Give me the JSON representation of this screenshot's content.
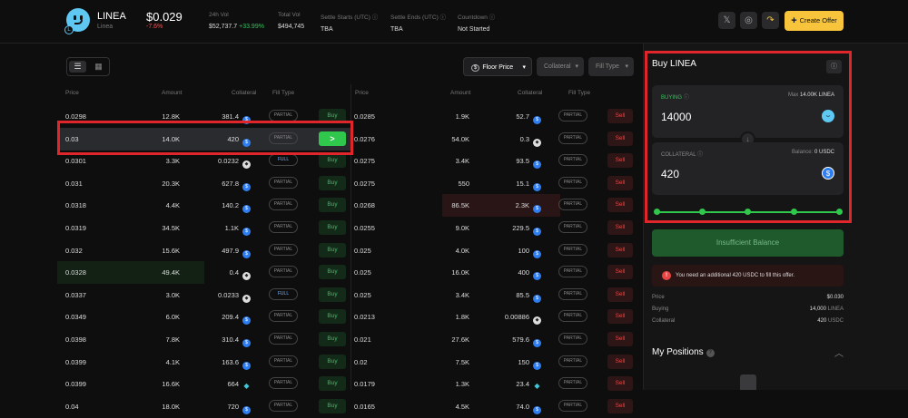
{
  "token": {
    "symbol": "LINEA",
    "name": "Linea",
    "price": "$0.029",
    "change": "-7.6%"
  },
  "stats": [
    {
      "label": "24h Vol",
      "value": "$52,737.7",
      "delta": "+33.99%"
    },
    {
      "label": "Total Vol",
      "value": "$494,745",
      "delta": ""
    },
    {
      "label": "Settle Starts (UTC)",
      "value": "TBA",
      "delta": ""
    },
    {
      "label": "Settle Ends (UTC)",
      "value": "TBA",
      "delta": ""
    },
    {
      "label": "Countdown",
      "value": "Not Started",
      "delta": ""
    }
  ],
  "header_buttons": {
    "x": "𝕏",
    "globe": "◎",
    "share": "↷",
    "create_offer": "Create Offer"
  },
  "filters": {
    "sort": "Floor Price",
    "collateral": "Collateral",
    "fill_type": "Fill Type"
  },
  "columns": {
    "price": "Price",
    "amount": "Amount",
    "collateral": "Collateral",
    "fill_type": "Fill Type"
  },
  "buy_orders": [
    {
      "price": "0.0298",
      "amount": "12.8K",
      "collateral": "381.4",
      "coin": "usdc",
      "fill": "PARTIAL",
      "action": "Buy"
    },
    {
      "price": "0.03",
      "amount": "14.0K",
      "collateral": "420",
      "coin": "usdc",
      "fill": "PARTIAL",
      "action": ">"
    },
    {
      "price": "0.0301",
      "amount": "3.3K",
      "collateral": "0.0232",
      "coin": "eth",
      "fill": "FULL",
      "action": "Buy"
    },
    {
      "price": "0.031",
      "amount": "20.3K",
      "collateral": "627.8",
      "coin": "usdc",
      "fill": "PARTIAL",
      "action": "Buy"
    },
    {
      "price": "0.0318",
      "amount": "4.4K",
      "collateral": "140.2",
      "coin": "usdc",
      "fill": "PARTIAL",
      "action": "Buy"
    },
    {
      "price": "0.0319",
      "amount": "34.5K",
      "collateral": "1.1K",
      "coin": "usdc",
      "fill": "PARTIAL",
      "action": "Buy"
    },
    {
      "price": "0.032",
      "amount": "15.6K",
      "collateral": "497.9",
      "coin": "usdc",
      "fill": "PARTIAL",
      "action": "Buy"
    },
    {
      "price": "0.0328",
      "amount": "49.4K",
      "collateral": "0.4",
      "coin": "eth",
      "fill": "PARTIAL",
      "action": "Buy"
    },
    {
      "price": "0.0337",
      "amount": "3.0K",
      "collateral": "0.0233",
      "coin": "eth",
      "fill": "FULL",
      "action": "Buy"
    },
    {
      "price": "0.0349",
      "amount": "6.0K",
      "collateral": "209.4",
      "coin": "usdc",
      "fill": "PARTIAL",
      "action": "Buy"
    },
    {
      "price": "0.0398",
      "amount": "7.8K",
      "collateral": "310.4",
      "coin": "usdc",
      "fill": "PARTIAL",
      "action": "Buy"
    },
    {
      "price": "0.0399",
      "amount": "4.1K",
      "collateral": "163.6",
      "coin": "usdc",
      "fill": "PARTIAL",
      "action": "Buy"
    },
    {
      "price": "0.0399",
      "amount": "16.6K",
      "collateral": "664",
      "coin": "gem",
      "fill": "PARTIAL",
      "action": "Buy"
    },
    {
      "price": "0.04",
      "amount": "18.0K",
      "collateral": "720",
      "coin": "usdc",
      "fill": "PARTIAL",
      "action": "Buy"
    }
  ],
  "sell_orders": [
    {
      "price": "0.0285",
      "amount": "1.9K",
      "collateral": "52.7",
      "coin": "usdc",
      "fill": "PARTIAL",
      "action": "Sell"
    },
    {
      "price": "0.0276",
      "amount": "54.0K",
      "collateral": "0.3",
      "coin": "eth",
      "fill": "PARTIAL",
      "action": "Sell"
    },
    {
      "price": "0.0275",
      "amount": "3.4K",
      "collateral": "93.5",
      "coin": "usdc",
      "fill": "PARTIAL",
      "action": "Sell"
    },
    {
      "price": "0.0275",
      "amount": "550",
      "collateral": "15.1",
      "coin": "usdc",
      "fill": "PARTIAL",
      "action": "Sell"
    },
    {
      "price": "0.0268",
      "amount": "86.5K",
      "collateral": "2.3K",
      "coin": "usdc",
      "fill": "PARTIAL",
      "action": "Sell"
    },
    {
      "price": "0.0255",
      "amount": "9.0K",
      "collateral": "229.5",
      "coin": "usdc",
      "fill": "PARTIAL",
      "action": "Sell"
    },
    {
      "price": "0.025",
      "amount": "4.0K",
      "collateral": "100",
      "coin": "usdc",
      "fill": "PARTIAL",
      "action": "Sell"
    },
    {
      "price": "0.025",
      "amount": "16.0K",
      "collateral": "400",
      "coin": "usdc",
      "fill": "PARTIAL",
      "action": "Sell"
    },
    {
      "price": "0.025",
      "amount": "3.4K",
      "collateral": "85.5",
      "coin": "usdc",
      "fill": "PARTIAL",
      "action": "Sell"
    },
    {
      "price": "0.0213",
      "amount": "1.8K",
      "collateral": "0.00886",
      "coin": "eth",
      "fill": "PARTIAL",
      "action": "Sell"
    },
    {
      "price": "0.021",
      "amount": "27.6K",
      "collateral": "579.6",
      "coin": "usdc",
      "fill": "PARTIAL",
      "action": "Sell"
    },
    {
      "price": "0.02",
      "amount": "7.5K",
      "collateral": "150",
      "coin": "usdc",
      "fill": "PARTIAL",
      "action": "Sell"
    },
    {
      "price": "0.0179",
      "amount": "1.3K",
      "collateral": "23.4",
      "coin": "gem",
      "fill": "PARTIAL",
      "action": "Sell"
    },
    {
      "price": "0.0165",
      "amount": "4.5K",
      "collateral": "74.0",
      "coin": "usdc",
      "fill": "PARTIAL",
      "action": "Sell"
    }
  ],
  "buy_panel": {
    "title": "Buy LINEA",
    "buying_label": "BUYING",
    "max_label": "Max",
    "max_value": "14.00K LINEA",
    "buying_value": "14000",
    "collateral_label": "COLLATERAL",
    "balance_label": "Balance:",
    "balance_value": "0 USDC",
    "collateral_value": "420",
    "slider_value_pct": 100,
    "button": "Insufficient Balance",
    "warning": "You need an additional 420 USDC to fill this offer.",
    "summary": [
      {
        "label": "Price",
        "value": "$0.030",
        "unit": ""
      },
      {
        "label": "Buying",
        "value": "14,000",
        "unit": "LINEA"
      },
      {
        "label": "Collateral",
        "value": "420",
        "unit": "USDC"
      }
    ],
    "positions_title": "My Positions"
  },
  "colors": {
    "accent": "#f7c43c",
    "buy": "#2fc84d",
    "sell": "#e84545",
    "highlight": "#e0262a"
  }
}
